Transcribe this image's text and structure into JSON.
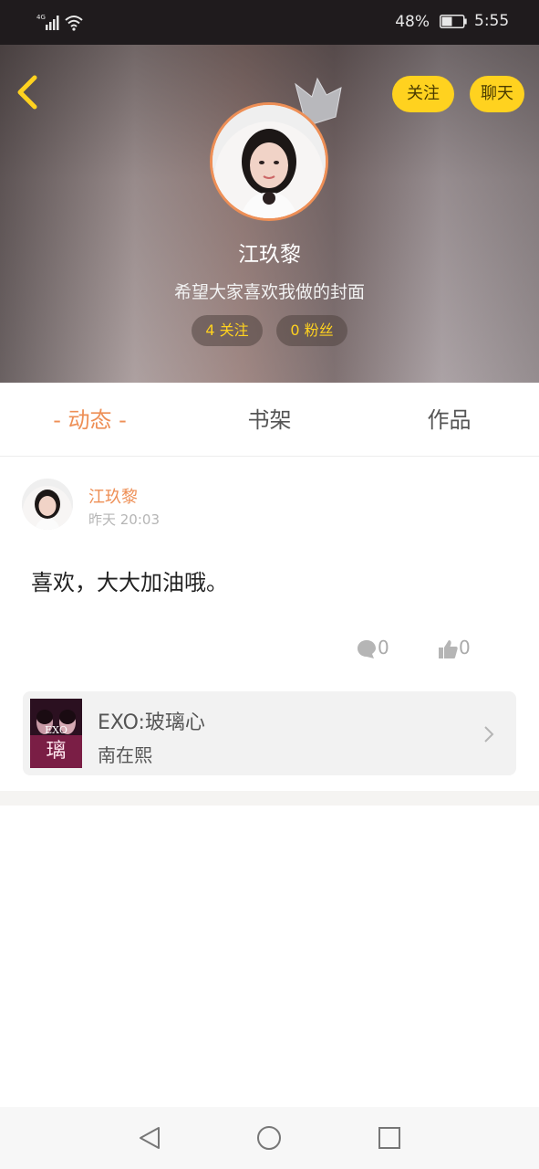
{
  "status_bar": {
    "network": "4G",
    "battery_percent": "48%",
    "time": "5:55",
    "battery_level": 0.48
  },
  "header": {
    "follow_label": "关注",
    "chat_label": "聊天",
    "user_name": "江玖黎",
    "bio": "希望大家喜欢我做的封面",
    "following": "4 关注",
    "fans": "0 粉丝"
  },
  "tabs": [
    {
      "label": "- 动态 -",
      "active": true
    },
    {
      "label": "书架",
      "active": false
    },
    {
      "label": "作品",
      "active": false
    }
  ],
  "post": {
    "author": "江玖黎",
    "time": "昨天 20:03",
    "text": "喜欢，大大加油哦。",
    "comments": "0",
    "likes": "0",
    "book": {
      "title": "EXO:玻璃心",
      "author": "南在熙",
      "cover_text": "EXO",
      "cover_char": "璃"
    }
  },
  "colors": {
    "accent": "#ee8f56",
    "button_yellow": "#ffd21f"
  },
  "icons": [
    "back-arrow-icon",
    "crown-icon",
    "comment-icon",
    "thumbs-up-icon",
    "chevron-right-icon",
    "nav-back-icon",
    "nav-home-icon",
    "nav-recents-icon"
  ]
}
